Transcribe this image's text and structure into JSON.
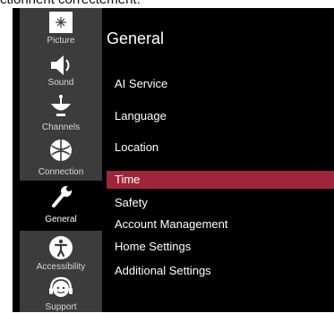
{
  "caption": "ctionnent correctement.",
  "sidebar": {
    "items": [
      {
        "label": "Picture",
        "icon": "picture-icon"
      },
      {
        "label": "Sound",
        "icon": "speaker-icon"
      },
      {
        "label": "Channels",
        "icon": "satellite-dish-icon"
      },
      {
        "label": "Connection",
        "icon": "globe-icon"
      },
      {
        "label": "General",
        "icon": "wrench-icon"
      },
      {
        "label": "Accessibility",
        "icon": "accessibility-icon"
      },
      {
        "label": "Support",
        "icon": "headset-icon"
      }
    ]
  },
  "main": {
    "title": "General",
    "items": [
      {
        "label": "AI Service"
      },
      {
        "label": "Language"
      },
      {
        "label": "Location"
      },
      {
        "label": "Time"
      },
      {
        "label": "Safety"
      },
      {
        "label": "Account Management"
      },
      {
        "label": "Home Settings"
      },
      {
        "label": "Additional Settings"
      }
    ]
  },
  "colors": {
    "selected": "#a0253a",
    "sidebar": "#3c3c3c",
    "background": "#000000"
  }
}
